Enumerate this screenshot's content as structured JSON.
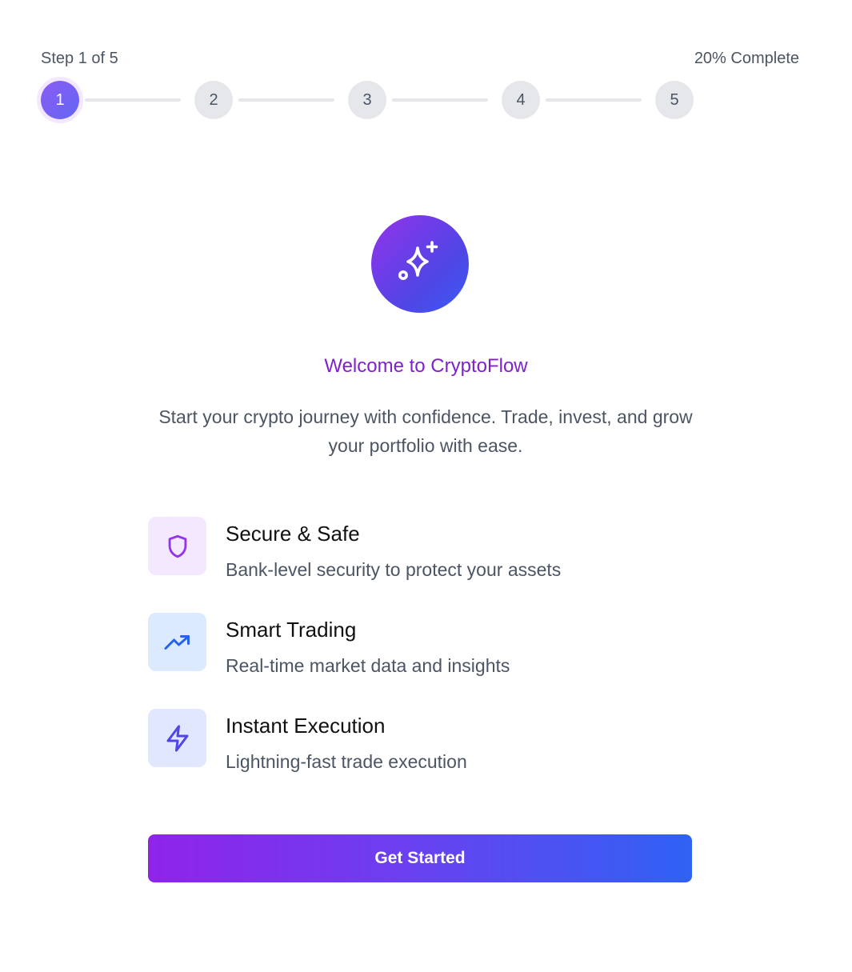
{
  "progress": {
    "step_text": "Step 1 of 5",
    "percent_text": "20% Complete",
    "steps": [
      "1",
      "2",
      "3",
      "4",
      "5"
    ],
    "current_step": 1
  },
  "hero": {
    "icon": "sparkles-icon",
    "title": "Welcome to CryptoFlow",
    "subtitle": "Start your crypto journey with confidence. Trade, invest, and grow your portfolio with ease."
  },
  "features": [
    {
      "icon": "shield-icon",
      "title": "Secure & Safe",
      "description": "Bank-level security to protect your assets",
      "icon_color": "#9333ea",
      "tile_color": "#f3e8ff"
    },
    {
      "icon": "trending-up-icon",
      "title": "Smart Trading",
      "description": "Real-time market data and insights",
      "icon_color": "#2563eb",
      "tile_color": "#dbeafe"
    },
    {
      "icon": "lightning-icon",
      "title": "Instant Execution",
      "description": "Lightning-fast trade execution",
      "icon_color": "#4f46e5",
      "tile_color": "#e0e7ff"
    }
  ],
  "cta": {
    "label": "Get Started"
  },
  "colors": {
    "accent_purple": "#9333ea",
    "accent_blue": "#2563eb",
    "inactive_step": "#e5e7eb",
    "muted_text": "#4b5563"
  }
}
